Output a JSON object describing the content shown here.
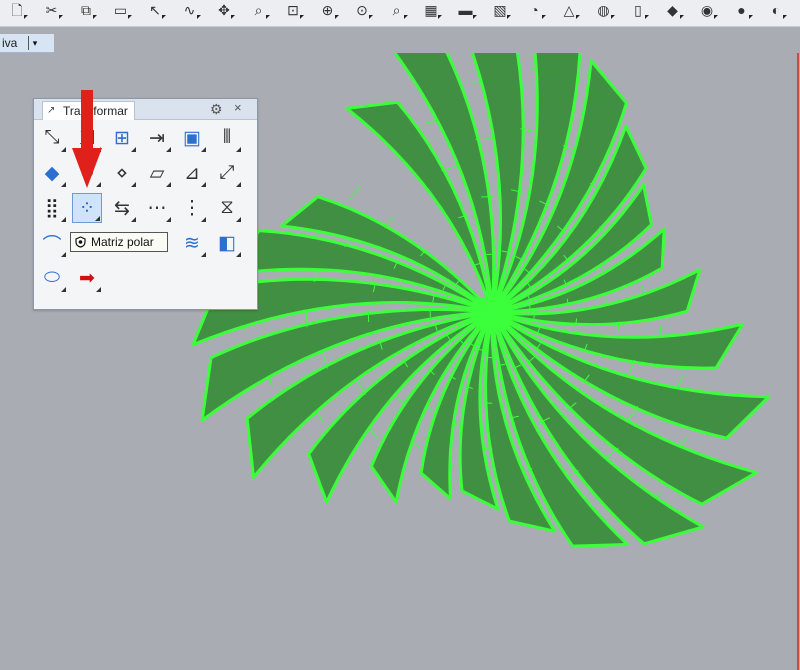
{
  "toolbar": {
    "icons": [
      "new-file-icon",
      "cut-icon",
      "copy-icon",
      "paste-icon",
      "select-icon",
      "curve-icon",
      "pan-icon",
      "zoom-icon",
      "zoom-window-icon",
      "zoom-extents-icon",
      "zoom-selected-icon",
      "zoom-dynamic-icon",
      "viewport-layout-icon",
      "car-icon",
      "grid-snap-icon",
      "history-icon",
      "analysis-icon",
      "light-bulb-icon",
      "layer-icon",
      "render-icon",
      "color-wheel-icon",
      "shaded-sphere-icon",
      "rendered-sphere-icon"
    ]
  },
  "viewport": {
    "label": "iva",
    "dropdown_glyph": "▾"
  },
  "panel": {
    "tab_label": "Transformar",
    "gear_glyph": "⚙",
    "close_glyph": "×",
    "buttons": [
      [
        "move-icon",
        "copy-transform-icon",
        "array-icon",
        "orient-icon",
        "box-morph-icon",
        "mirror-icon"
      ],
      [
        "diamond-icon",
        "rotate-icon",
        "point-icon",
        "plane-icon",
        "shear-icon",
        "scale-icon"
      ],
      [
        "rectangular-array-icon",
        "polar-array-icon",
        "scale-1d-icon",
        "linear-array-icon",
        "array-along-curve-icon",
        "twist-icon"
      ],
      [
        "bend-icon",
        "",
        "",
        "",
        "flow-icon",
        "taper-icon"
      ],
      [
        "cage-edit-icon",
        "arrow-right-icon"
      ]
    ],
    "selected": "polar-array-icon"
  },
  "tooltip": {
    "text": "Matriz polar"
  },
  "colors": {
    "model_green": "#3cff3c",
    "model_fill": "#2f8a2f",
    "background": "#a9adb3",
    "arrow": "#e0201b"
  }
}
